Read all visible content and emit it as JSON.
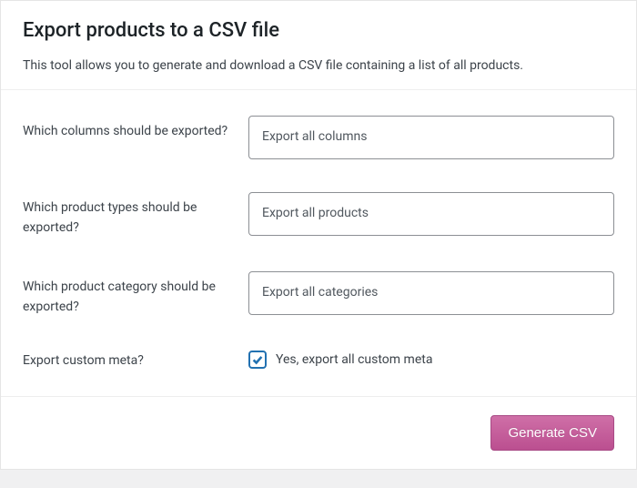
{
  "header": {
    "title": "Export products to a CSV file",
    "description": "This tool allows you to generate and download a CSV file containing a list of all products."
  },
  "form": {
    "columns": {
      "label": "Which columns should be exported?",
      "placeholder": "Export all columns"
    },
    "product_types": {
      "label": "Which product types should be exported?",
      "placeholder": "Export all products"
    },
    "category": {
      "label": "Which product category should be exported?",
      "placeholder": "Export all categories"
    },
    "custom_meta": {
      "label": "Export custom meta?",
      "checkbox_label": "Yes, export all custom meta",
      "checked": true
    }
  },
  "footer": {
    "submit_label": "Generate CSV"
  }
}
